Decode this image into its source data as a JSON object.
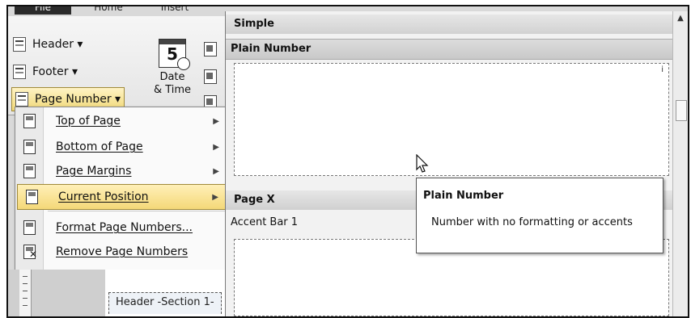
{
  "ribbon": {
    "tabs": [
      "File",
      "Home",
      "Insert"
    ],
    "header_label": "Header ▾",
    "footer_label": "Footer ▾",
    "page_number_label": "Page Number ▾",
    "datetime_label_1": "Date",
    "datetime_label_2": "& Time",
    "calendar_day": "5"
  },
  "menu": {
    "items": [
      {
        "label": "Top of Page",
        "icon": "page-top-icon",
        "has_submenu": true
      },
      {
        "label": "Bottom of Page",
        "icon": "page-bottom-icon",
        "has_submenu": true
      },
      {
        "label": "Page Margins",
        "icon": "page-margins-icon",
        "has_submenu": true
      },
      {
        "label": "Current Position",
        "icon": "current-position-icon",
        "has_submenu": true,
        "highlighted": true
      },
      {
        "label": "Format Page Numbers...",
        "icon": "format-page-numbers-icon",
        "has_submenu": false
      },
      {
        "label": "Remove Page Numbers",
        "icon": "remove-page-numbers-icon",
        "has_submenu": false
      }
    ]
  },
  "document": {
    "header_tab": "Header -Section 1-"
  },
  "gallery": {
    "section_simple": "Simple",
    "item_plain_number": "Plain Number",
    "section_page_x": "Page X",
    "item_accent_bar": "Accent Bar 1",
    "thumb_marker": "i"
  },
  "tooltip": {
    "title": "Plain Number",
    "body": "Number with no formatting or accents"
  },
  "colors": {
    "highlight": "#f4d878",
    "highlight_border": "#a08a3a",
    "gallery_bg": "#f2f2f2"
  }
}
